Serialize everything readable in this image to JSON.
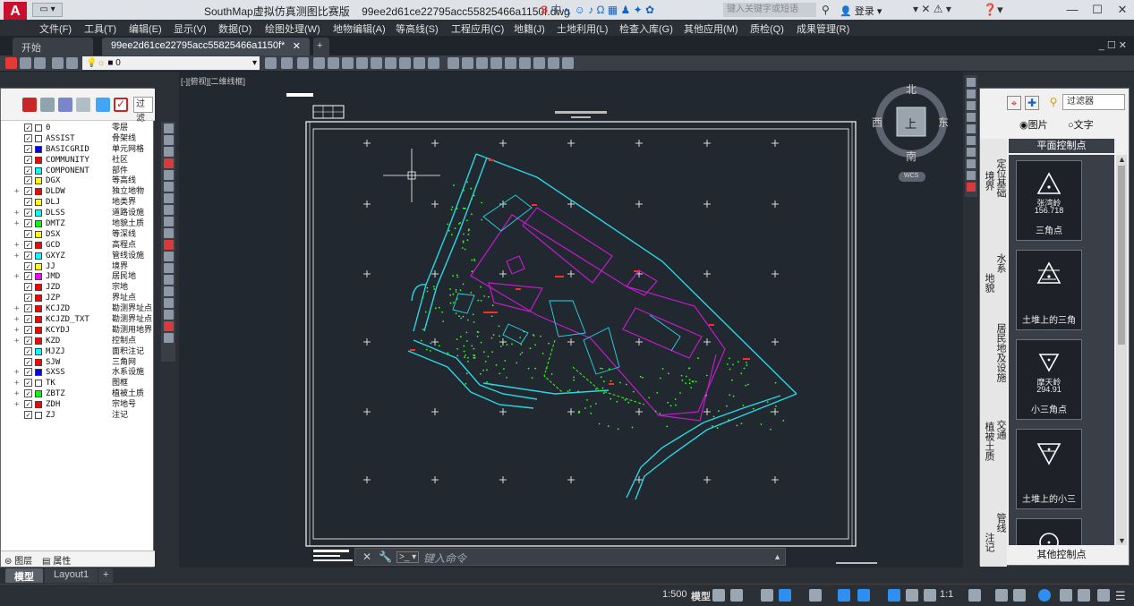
{
  "titlebar": {
    "app_logo": "A",
    "qa_label": "▭ ▾",
    "title": "SouthMap虚拟仿真测图比赛版",
    "filename": "99ee2d61ce22795acc55825466a1150f.dwg",
    "ime_logo": "S",
    "ime_label": "中",
    "search_placeholder": "键入关键字或短语",
    "login": "登录"
  },
  "menu": [
    "文件(F)",
    "工具(T)",
    "编辑(E)",
    "显示(V)",
    "数据(D)",
    "绘图处理(W)",
    "地物编辑(A)",
    "等高线(S)",
    "工程应用(C)",
    "地籍(J)",
    "土地利用(L)",
    "检查入库(G)",
    "其他应用(M)",
    "质检(Q)",
    "成果管理(R)"
  ],
  "tabs": {
    "start": "开始",
    "active": "99ee2d61ce22795acc55825466a1150f*",
    "add": "+"
  },
  "toolbar": {
    "layer_combo": "0"
  },
  "layer_panel": {
    "filter": "过滤",
    "layers": [
      {
        "name": "0",
        "desc": "零层",
        "color": "#ffffff",
        "exp": ""
      },
      {
        "name": "ASSIST",
        "desc": "骨架线",
        "color": "#ffffff",
        "exp": ""
      },
      {
        "name": "BASICGRID",
        "desc": "单元网格",
        "color": "#0000ff",
        "exp": ""
      },
      {
        "name": "COMMUNITY",
        "desc": "社区",
        "color": "#ff0000",
        "exp": ""
      },
      {
        "name": "COMPONENT",
        "desc": "部件",
        "color": "#00ffff",
        "exp": ""
      },
      {
        "name": "DGX",
        "desc": "等高线",
        "color": "#ffff00",
        "exp": ""
      },
      {
        "name": "DLDW",
        "desc": "独立地物",
        "color": "#ff0000",
        "exp": "+"
      },
      {
        "name": "DLJ",
        "desc": "地类界",
        "color": "#ffff00",
        "exp": ""
      },
      {
        "name": "DLSS",
        "desc": "道路设施",
        "color": "#00ffff",
        "exp": "+"
      },
      {
        "name": "DMTZ",
        "desc": "地貌土质",
        "color": "#00ff00",
        "exp": "+"
      },
      {
        "name": "DSX",
        "desc": "等深线",
        "color": "#ffff00",
        "exp": ""
      },
      {
        "name": "GCD",
        "desc": "高程点",
        "color": "#ff0000",
        "exp": "+"
      },
      {
        "name": "GXYZ",
        "desc": "管线设施",
        "color": "#00ffff",
        "exp": "+"
      },
      {
        "name": "JJ",
        "desc": "境界",
        "color": "#ffff00",
        "exp": ""
      },
      {
        "name": "JMD",
        "desc": "居民地",
        "color": "#ff00ff",
        "exp": "+"
      },
      {
        "name": "JZD",
        "desc": "宗地",
        "color": "#ff0000",
        "exp": ""
      },
      {
        "name": "JZP",
        "desc": "界址点",
        "color": "#ff0000",
        "exp": ""
      },
      {
        "name": "KCJZD",
        "desc": "勘测界址点",
        "color": "#ff0000",
        "exp": "+"
      },
      {
        "name": "KCJZD_TXT",
        "desc": "勘测界址点",
        "color": "#ff0000",
        "exp": "+"
      },
      {
        "name": "KCYDJ",
        "desc": "勘测用地界",
        "color": "#ff0000",
        "exp": "+"
      },
      {
        "name": "KZD",
        "desc": "控制点",
        "color": "#ff0000",
        "exp": "+"
      },
      {
        "name": "MJZJ",
        "desc": "面积注记",
        "color": "#00ffff",
        "exp": ""
      },
      {
        "name": "SJW",
        "desc": "三角网",
        "color": "#ff0000",
        "exp": ""
      },
      {
        "name": "SXSS",
        "desc": "水系设施",
        "color": "#0000ff",
        "exp": "+"
      },
      {
        "name": "TK",
        "desc": "图框",
        "color": "#ffffff",
        "exp": "+"
      },
      {
        "name": "ZBTZ",
        "desc": "植被土质",
        "color": "#00ff00",
        "exp": "+"
      },
      {
        "name": "ZDH",
        "desc": "宗地号",
        "color": "#ff0000",
        "exp": "+"
      },
      {
        "name": "ZJ",
        "desc": "注记",
        "color": "#ffffff",
        "exp": ""
      }
    ],
    "tab_layers": "图层",
    "tab_props": "属性"
  },
  "canvas": {
    "view_label": "[-][俯视][二维线框]",
    "viewcube": {
      "n": "北",
      "s": "南",
      "e": "东",
      "w": "西",
      "top": "上",
      "wcs": "WCS"
    }
  },
  "symbol_panel": {
    "filter": "过滤器",
    "radio_image": "图片",
    "radio_text": "文字",
    "categories_left": [
      "境界",
      "地貌",
      "植被土质",
      "注记"
    ],
    "categories_right": [
      "定位基础",
      "水系",
      "居民地及设施",
      "交通",
      "管线"
    ],
    "header": "平面控制点",
    "symbols": [
      {
        "label": "三角点",
        "sub1": "张湾岭",
        "sub2": "156.718"
      },
      {
        "label": "土堆上的三角",
        "sub1": "",
        "sub2": ""
      },
      {
        "label": "小三角点",
        "sub1": "摩天岭",
        "sub2": "294.91"
      },
      {
        "label": "土堆上的小三",
        "sub1": "",
        "sub2": ""
      },
      {
        "label": "",
        "sub1": "",
        "sub2": ""
      }
    ],
    "footer": "其他控制点"
  },
  "command": {
    "placeholder": "键入命令"
  },
  "layout_tabs": [
    "模型",
    "Layout1",
    "+"
  ],
  "status": {
    "scale": "1:500",
    "space": "模型",
    "annoscale": "1:1"
  }
}
